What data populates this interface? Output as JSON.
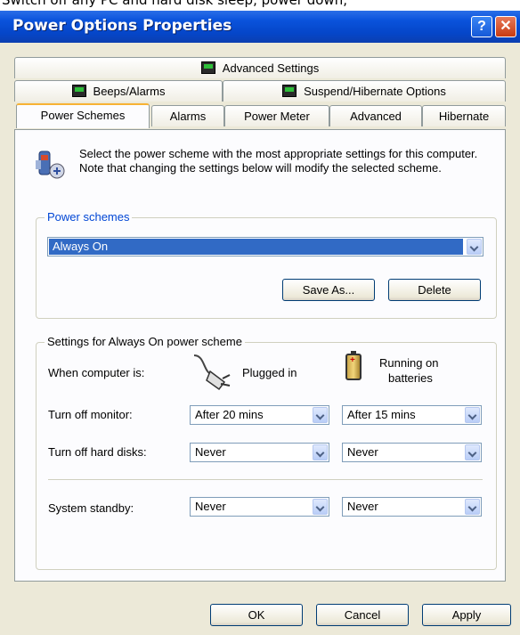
{
  "window": {
    "top_cut_text": "Switch off any PC and hard disk sleep, power down,",
    "title": "Power Options Properties",
    "help_glyph": "?",
    "close_glyph": "✕"
  },
  "tabs": {
    "row1": [
      {
        "label": "Advanced Settings",
        "icon": "monitor-icon"
      }
    ],
    "row2": [
      {
        "label": "Beeps/Alarms",
        "icon": "monitor-icon"
      },
      {
        "label": "Suspend/Hibernate Options",
        "icon": "monitor-icon"
      }
    ],
    "row3": [
      {
        "label": "Power Schemes",
        "active": true
      },
      {
        "label": "Alarms"
      },
      {
        "label": "Power Meter"
      },
      {
        "label": "Advanced"
      },
      {
        "label": "Hibernate"
      }
    ]
  },
  "intro": {
    "text": "Select the power scheme with the most appropriate settings for this computer. Note that changing the settings below will modify the selected scheme."
  },
  "power_schemes": {
    "legend": "Power schemes",
    "selected": "Always On",
    "save_as": "Save As...",
    "delete": "Delete"
  },
  "settings": {
    "legend": "Settings for Always On power scheme",
    "when_label": "When computer is:",
    "plugged_in": "Plugged in",
    "running_on": "Running on",
    "batteries": "batteries",
    "rows": [
      {
        "label": "Turn off monitor:",
        "plugged": "After 20 mins",
        "battery": "After 15 mins"
      },
      {
        "label": "Turn off hard disks:",
        "plugged": "Never",
        "battery": "Never"
      },
      {
        "label": "System standby:",
        "plugged": "Never",
        "battery": "Never"
      }
    ]
  },
  "footer": {
    "ok": "OK",
    "cancel": "Cancel",
    "apply": "Apply"
  },
  "colors": {
    "titlebar": "#0a53dc",
    "dialog_bg": "#ece9d8",
    "selection": "#316ac5",
    "active_tab_accent": "#f7b234"
  }
}
